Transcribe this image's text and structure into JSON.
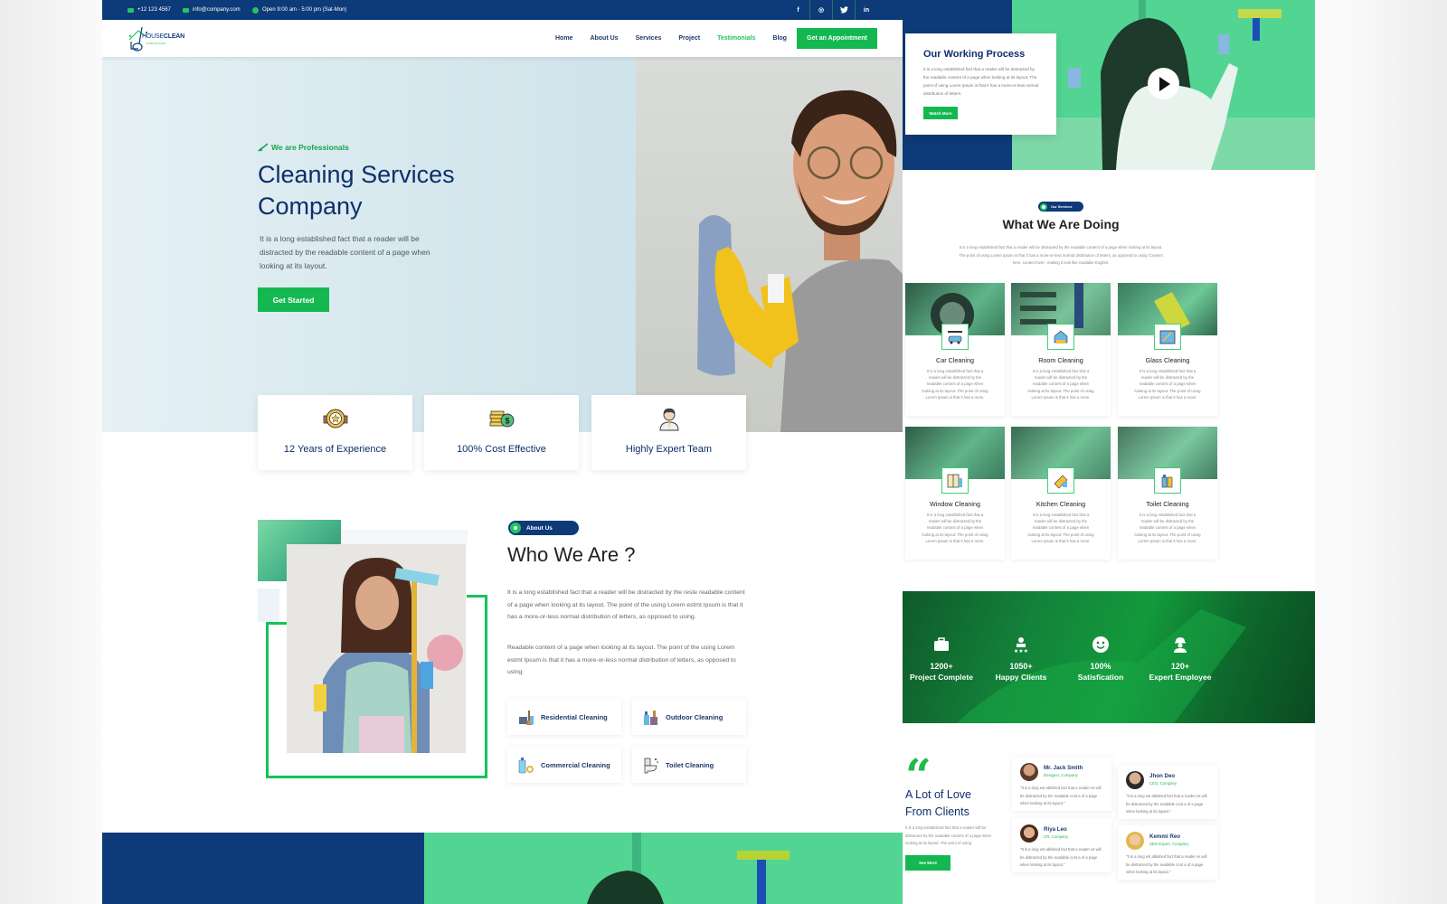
{
  "topbar": {
    "phone": "+12 123 4567",
    "email": "info@company.com",
    "hours": "Open 9:00 am - 5:00 pm (Sat-Mon)",
    "social": [
      "f",
      "◎",
      "t",
      "in"
    ]
  },
  "brand": {
    "name_a": "HOUSE",
    "name_b": "CLEAN",
    "tagline": "YOUR SLOGAN"
  },
  "nav": {
    "items": [
      {
        "label": "Home"
      },
      {
        "label": "About Us"
      },
      {
        "label": "Services"
      },
      {
        "label": "Project"
      },
      {
        "label": "Testimonials"
      },
      {
        "label": "Blog"
      }
    ],
    "active": "Testimonials",
    "cta": "Get an Appointment"
  },
  "hero": {
    "kicker": "We are Professionals",
    "title": "Cleaning Services Company",
    "desc": "It is a long established fact that a reader will be distracted by the readable content of a page when looking at its layout.",
    "cta": "Get Started"
  },
  "features": [
    {
      "icon": "award-badge-icon",
      "label": "12 Years of Experience"
    },
    {
      "icon": "coins-dollar-icon",
      "label": "100% Cost Effective"
    },
    {
      "icon": "expert-person-icon",
      "label": "Highly Expert Team"
    }
  ],
  "about": {
    "badge": "About Us",
    "title": "Who We Are ?",
    "p1": "It is a long established fact that a reader will be distracted by the reste readable content of a page when looking at its layout. The point of the using Lorem estmt Ipsum is that it has a more-or-less normal distribution of letters, as opposed to using.",
    "p2": "Readable content of a page when looking at its layout. The point of the using Lorem estmt Ipsum is that it has a more-or-less normal distribution of letters, as opposed to using.",
    "services": [
      {
        "label": "Residential Cleaning"
      },
      {
        "label": "Outdoor Cleaning"
      },
      {
        "label": "Commercial Cleaning"
      },
      {
        "label": "Toilet Cleaning"
      }
    ]
  },
  "working_process": {
    "title": "Our Working Process",
    "desc": "It is a long established fact that a reader will be distracted by the readable content of a page when looking at its layout. The point of using Lorem Ipsum is that it has a more-or-less normal distribution of letters.",
    "cta": "Watch More"
  },
  "services": {
    "badge": "Our Services",
    "title": "What We Are Doing",
    "desc": "It is a long established fact that a reader will be distracted by the readable content of a page when looking at its layout. The point of using Lorem Ipsum is that it has a more-or-less normal distribution of letters, as opposed to using 'Content here, content here', making it look like readable English.",
    "card_desc": "It is a long established fact that a reader will be distracted by the readable content of a page when looking at its layout. The point of using Lorem Ipsum is that it has a more.",
    "items": [
      {
        "label": "Car Cleaning"
      },
      {
        "label": "Room Cleaning"
      },
      {
        "label": "Glass Cleaning"
      },
      {
        "label": "Window Cleaning"
      },
      {
        "label": "Kitchen Cleaning"
      },
      {
        "label": "Toilet Cleaning"
      }
    ]
  },
  "stats": [
    {
      "value": "1200+",
      "label": "Project Complete"
    },
    {
      "value": "1050+",
      "label": "Happy Clients"
    },
    {
      "value": "100%",
      "label": "Satisfication"
    },
    {
      "value": "120+",
      "label": "Expert Employee"
    }
  ],
  "testimonials": {
    "title": "A Lot of Love From Clients",
    "desc": "It is a long established fact that a reader will be distracted by the readable content of a page when looking at its layout. The point of using",
    "cta": "See More",
    "quote": "\"It is a long est ablished fact that a reader es will be distracted by the readable cont a of a page when looking at its layout.\"",
    "items": [
      {
        "name": "Mr. Jack Smith",
        "role": "Designer, Company"
      },
      {
        "name": "Jhon Deo",
        "role": "CEO, Company"
      },
      {
        "name": "Riya Leo",
        "role": "CR, Company"
      },
      {
        "name": "Kemmi Reo",
        "role": "SEO Expert, Company"
      }
    ]
  },
  "colors": {
    "navy": "#0d3a78",
    "green": "#14b850",
    "mint": "#52d592"
  }
}
